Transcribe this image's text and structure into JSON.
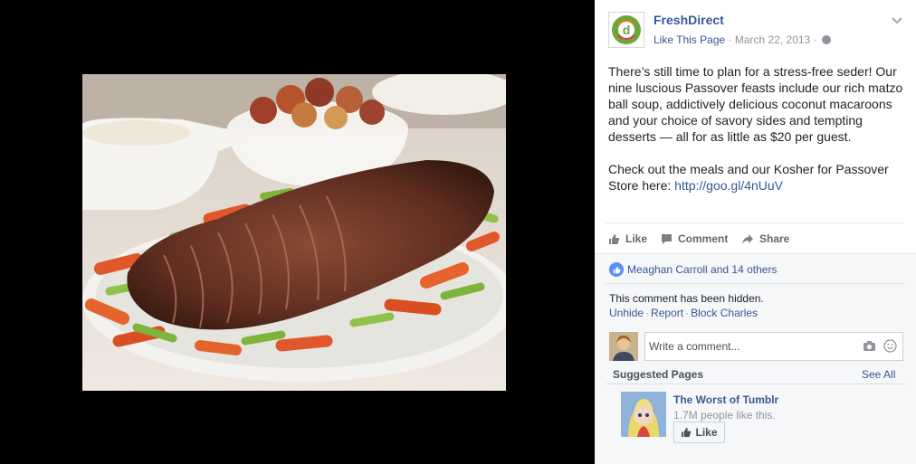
{
  "post": {
    "page_name": "FreshDirect",
    "like_page": "Like This Page",
    "date": "March 22, 2013",
    "separator": " · ",
    "text": "There’s still time to plan for a stress-free seder! Our nine luscious Passover feasts include our rich matzo ball soup, addictively delicious coconut macaroons and your choice of savory sides and tempting desserts — all for as little as $20 per guest.\n\nCheck out the meals and our Kosher for Passover Store here: ",
    "link": "http://goo.gl/4nUuV"
  },
  "actions": {
    "like": "Like",
    "comment": "Comment",
    "share": "Share"
  },
  "likes_summary": "Meaghan Carroll and 14 others",
  "hidden_comment": {
    "message": "This comment has been hidden.",
    "unhide": "Unhide",
    "report": "Report",
    "block": "Block Charles"
  },
  "comment_box": {
    "placeholder": "Write a comment..."
  },
  "suggested": {
    "title": "Suggested Pages",
    "see_all": "See All",
    "page_name": "The Worst of Tumblr",
    "likes": "1.7M people like this.",
    "like_button": "Like"
  },
  "colors": {
    "link_blue": "#365899",
    "like_blue": "#5890ff",
    "logo_green": "#6ba83a",
    "logo_orange": "#e8751a"
  },
  "icons": [
    "freshdirect-logo",
    "globe-icon",
    "chevron-down-icon",
    "thumbs-up-icon",
    "comment-icon",
    "share-icon",
    "camera-icon",
    "smile-icon"
  ]
}
